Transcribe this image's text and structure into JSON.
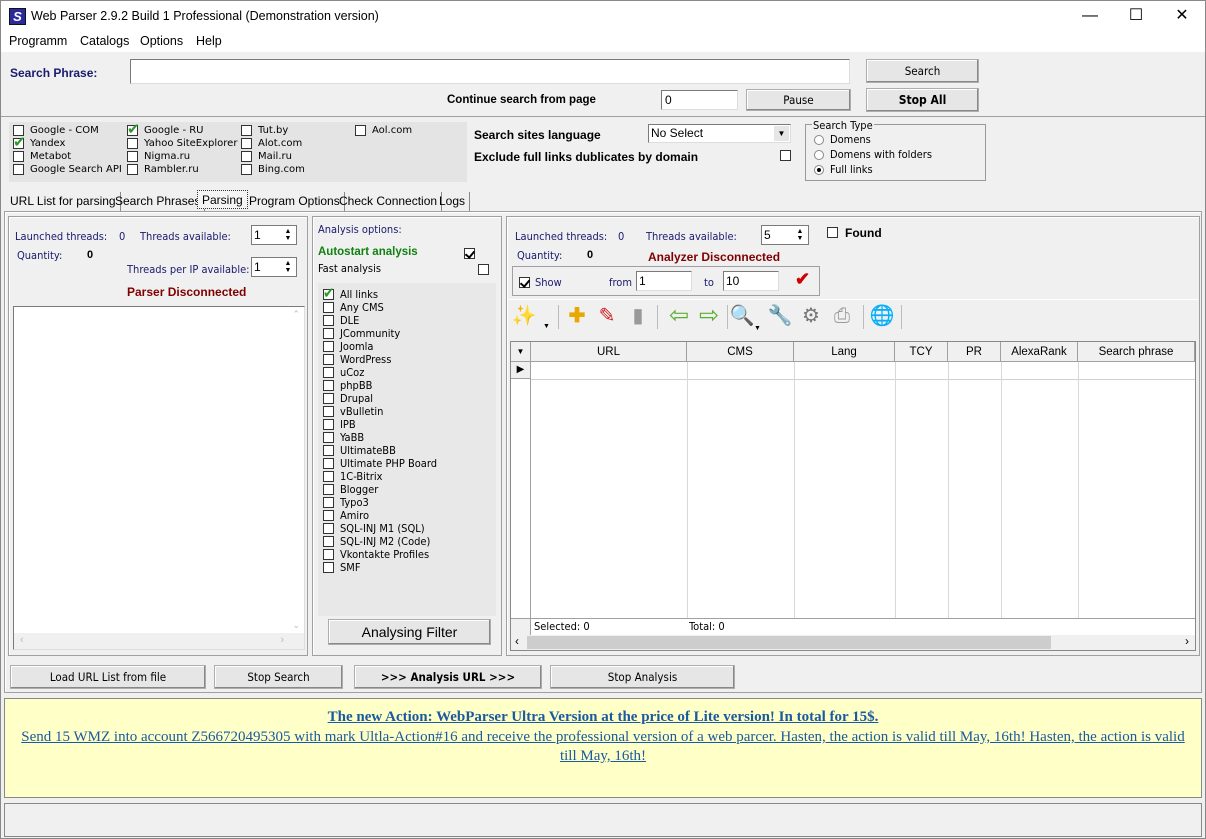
{
  "window": {
    "title": "Web Parser 2.9.2 Build 1 Professional (Demonstration version)",
    "minimize": "—",
    "maximize": "☐",
    "close": "✕"
  },
  "menu": [
    "Programm",
    "Catalogs",
    "Options",
    "Help"
  ],
  "search": {
    "label": "Search Phrase:",
    "value": "",
    "search_button": "Search",
    "continue_label": "Continue search from page",
    "page_value": "0",
    "pause_button": "Pause",
    "stop_all_button": "Stop All"
  },
  "engines": [
    {
      "label": "Google - COM",
      "checked": false
    },
    {
      "label": "Yandex",
      "checked": true
    },
    {
      "label": "Metabot",
      "checked": false
    },
    {
      "label": "Google Search API",
      "checked": false
    },
    {
      "label": "Google - RU",
      "checked": true
    },
    {
      "label": "Yahoo SiteExplorer",
      "checked": false
    },
    {
      "label": "Nigma.ru",
      "checked": false
    },
    {
      "label": "Rambler.ru",
      "checked": false
    },
    {
      "label": "Tut.by",
      "checked": false
    },
    {
      "label": "Alot.com",
      "checked": false
    },
    {
      "label": "Mail.ru",
      "checked": false
    },
    {
      "label": "Bing.com",
      "checked": false
    },
    {
      "label": "Aol.com",
      "checked": false
    }
  ],
  "options": {
    "language_label": "Search sites language",
    "language_value": "No Select",
    "exclude_label": "Exclude full links dublicates by domain",
    "exclude_checked": false
  },
  "search_type": {
    "title": "Search Type",
    "options": [
      {
        "label": "Domens",
        "selected": false
      },
      {
        "label": "Domens with folders",
        "selected": false
      },
      {
        "label": "Full links",
        "selected": true
      }
    ]
  },
  "tabs": [
    {
      "label": "URL List for parsing",
      "active": false
    },
    {
      "label": "Search Phrases",
      "active": false
    },
    {
      "label": "Parsing",
      "active": true
    },
    {
      "label": "Program Options",
      "active": false
    },
    {
      "label": "Check Connection",
      "active": false
    },
    {
      "label": "Logs",
      "active": false
    }
  ],
  "parser": {
    "launched_label": "Launched threads:",
    "launched_value": "0",
    "threads_label": "Threads available:",
    "threads_value": "1",
    "quantity_label": "Quantity:",
    "quantity_value": "0",
    "per_ip_label": "Threads per IP available:",
    "per_ip_value": "1",
    "status": "Parser Disconnected"
  },
  "analysis": {
    "title": "Analysis options:",
    "autostart_label": "Autostart analysis",
    "autostart_checked": true,
    "fast_label": "Fast analysis",
    "fast_checked": false,
    "cms": [
      {
        "label": "All links",
        "checked": true
      },
      {
        "label": "Any CMS",
        "checked": false
      },
      {
        "label": "DLE",
        "checked": false
      },
      {
        "label": "JCommunity",
        "checked": false
      },
      {
        "label": "Joomla",
        "checked": false
      },
      {
        "label": "WordPress",
        "checked": false
      },
      {
        "label": "uCoz",
        "checked": false
      },
      {
        "label": "phpBB",
        "checked": false
      },
      {
        "label": "Drupal",
        "checked": false
      },
      {
        "label": "vBulletin",
        "checked": false
      },
      {
        "label": "IPB",
        "checked": false
      },
      {
        "label": "YaBB",
        "checked": false
      },
      {
        "label": "UltimateBB",
        "checked": false
      },
      {
        "label": "Ultimate PHP Board",
        "checked": false
      },
      {
        "label": "1C-Bitrix",
        "checked": false
      },
      {
        "label": "Blogger",
        "checked": false
      },
      {
        "label": "Typo3",
        "checked": false
      },
      {
        "label": "Amiro",
        "checked": false
      },
      {
        "label": "SQL-INJ M1 (SQL)",
        "checked": false
      },
      {
        "label": "SQL-INJ M2 (Code)",
        "checked": false
      },
      {
        "label": "Vkontakte Profiles",
        "checked": false
      },
      {
        "label": "SMF",
        "checked": false
      }
    ],
    "filter_button": "Analysing Filter"
  },
  "analyzer": {
    "launched_label": "Launched threads:",
    "launched_value": "0",
    "threads_label": "Threads available:",
    "threads_value": "5",
    "found_label": "Found",
    "found_checked": false,
    "quantity_label": "Quantity:",
    "quantity_value": "0",
    "status": "Analyzer Disconnected",
    "show_label": "Show",
    "show_checked": true,
    "from_label": "from",
    "from_value": "1",
    "to_label": "to",
    "to_value": "10",
    "toolbar": [
      "magic-wand-icon",
      "add-document-icon",
      "edit-document-icon",
      "delete-document-icon",
      "arrow-left-icon",
      "arrow-right-icon",
      "folder-search-icon",
      "wrench-icon",
      "settings-tools-icon",
      "print-icon",
      "globe-icon"
    ]
  },
  "grid": {
    "columns": [
      "URL",
      "CMS",
      "Lang",
      "TCY",
      "PR",
      "AlexaRank",
      "Search phrase"
    ],
    "rows": [],
    "footer_selected": "Selected: 0",
    "footer_total": "Total: 0"
  },
  "buttons": {
    "load_list": "Load URL List from file",
    "stop_search": "Stop Search",
    "analysis_url": ">>> Analysis URL >>>",
    "stop_analysis": "Stop Analysis"
  },
  "promo": {
    "headline": "The new Action: WebParser Ultra Version at the price of Lite version! In total for 15$.",
    "body": "Send 15 WMZ into account Z566720495305 with mark Ultla-Action#16 and receive the professional version of a web parcer. Hasten, the action is valid till May, 16th! Hasten, the action is valid till May, 16th!"
  },
  "colors": {
    "disconnected": "#800000",
    "autostart": "#108010",
    "promo_bg": "#ffffc8",
    "promo_link": "#1a5aa0"
  }
}
